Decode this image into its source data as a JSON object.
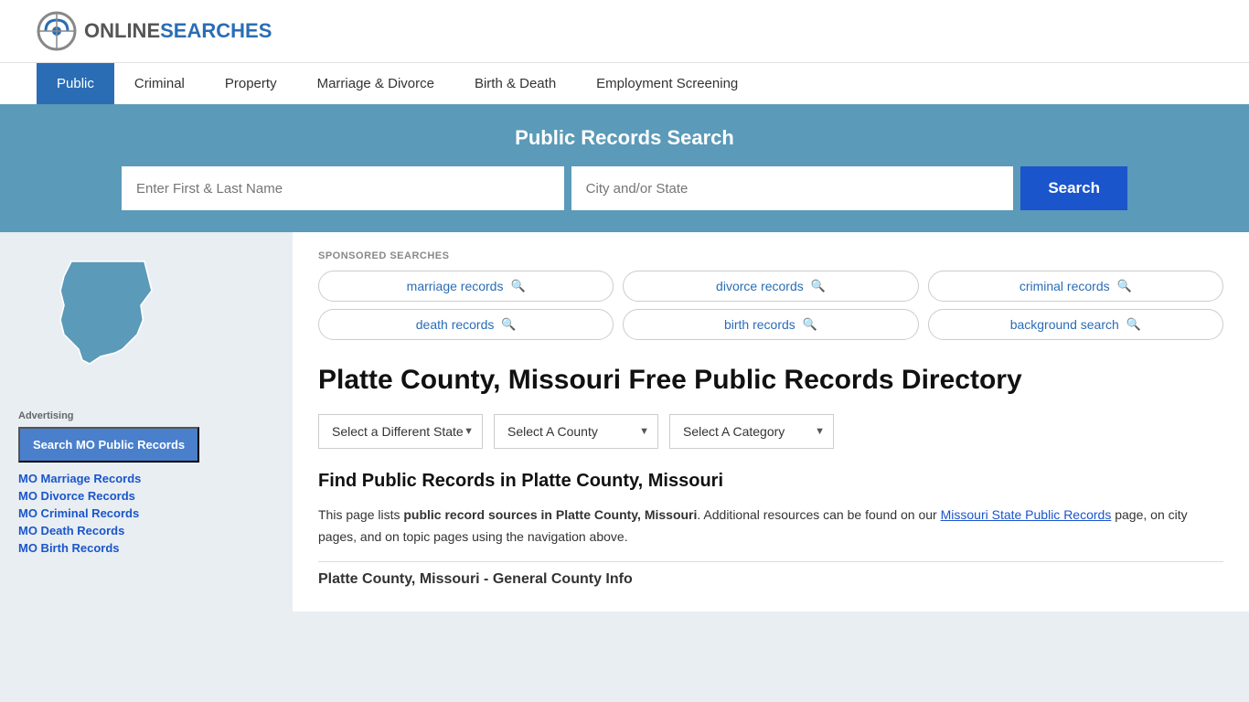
{
  "header": {
    "logo_online": "ONLINE",
    "logo_searches": "SEARCHES"
  },
  "nav": {
    "items": [
      {
        "label": "Public",
        "active": true
      },
      {
        "label": "Criminal",
        "active": false
      },
      {
        "label": "Property",
        "active": false
      },
      {
        "label": "Marriage & Divorce",
        "active": false
      },
      {
        "label": "Birth & Death",
        "active": false
      },
      {
        "label": "Employment Screening",
        "active": false
      }
    ]
  },
  "search_banner": {
    "title": "Public Records Search",
    "name_placeholder": "Enter First & Last Name",
    "city_placeholder": "City and/or State",
    "button_label": "Search"
  },
  "sponsored": {
    "label": "SPONSORED SEARCHES",
    "tags": [
      {
        "label": "marriage records"
      },
      {
        "label": "divorce records"
      },
      {
        "label": "criminal records"
      },
      {
        "label": "death records"
      },
      {
        "label": "birth records"
      },
      {
        "label": "background search"
      }
    ]
  },
  "content": {
    "page_title": "Platte County, Missouri Free Public Records Directory",
    "dropdowns": {
      "state_label": "Select a Different State",
      "county_label": "Select A County",
      "category_label": "Select A Category"
    },
    "find_title": "Find Public Records in Platte County, Missouri",
    "find_text_1": "This page lists ",
    "find_text_bold": "public record sources in Platte County, Missouri",
    "find_text_2": ". Additional resources can be found on our ",
    "find_link": "Missouri State Public Records",
    "find_text_3": " page, on city pages, and on topic pages using the navigation above.",
    "section_heading": "Platte County, Missouri - General County Info"
  },
  "sidebar": {
    "ad_label": "Advertising",
    "ad_button": "Search MO Public Records",
    "links": [
      {
        "label": "MO Marriage Records"
      },
      {
        "label": "MO Divorce Records"
      },
      {
        "label": "MO Criminal Records"
      },
      {
        "label": "MO Death Records"
      },
      {
        "label": "MO Birth Records"
      }
    ]
  }
}
